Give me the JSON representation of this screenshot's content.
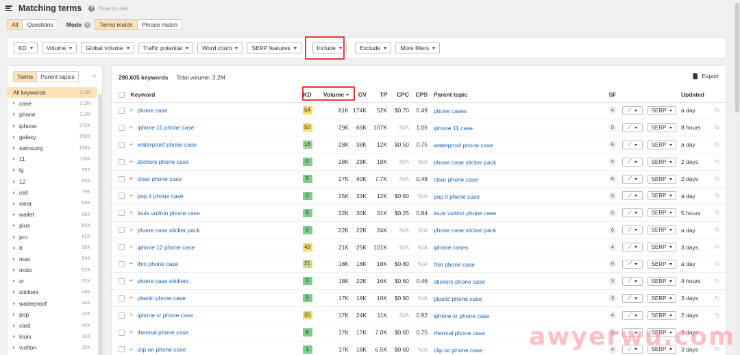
{
  "header": {
    "title": "Matching terms",
    "help_label": "How to use"
  },
  "mode_row": {
    "scope_options": [
      "All",
      "Questions"
    ],
    "mode_label": "Mode",
    "match_options": [
      "Terms match",
      "Phrase match"
    ]
  },
  "filters": [
    "KD",
    "Volume",
    "Global volume",
    "Traffic potential",
    "Word count",
    "SERP features",
    "Include",
    "Exclude",
    "More filters"
  ],
  "sidebar": {
    "tabs": [
      "Terms",
      "Parent topics"
    ],
    "collapse_glyph": "«",
    "all_label": "All keywords",
    "all_count": "3.2M",
    "items": [
      {
        "label": "case",
        "count": "3.2M"
      },
      {
        "label": "phone",
        "count": "3.2M"
      },
      {
        "label": "iphone",
        "count": "373K"
      },
      {
        "label": "galaxy",
        "count": "158K"
      },
      {
        "label": "samsung",
        "count": "158K"
      },
      {
        "label": "11",
        "count": "114K"
      },
      {
        "label": "lg",
        "count": "95K"
      },
      {
        "label": "12",
        "count": "80K"
      },
      {
        "label": "cell",
        "count": "79K"
      },
      {
        "label": "clear",
        "count": "69K"
      },
      {
        "label": "wallet",
        "count": "66K"
      },
      {
        "label": "plus",
        "count": "65K"
      },
      {
        "label": "pro",
        "count": "62K"
      },
      {
        "label": "6",
        "count": "55K"
      },
      {
        "label": "max",
        "count": "54K"
      },
      {
        "label": "moto",
        "count": "52K"
      },
      {
        "label": "xr",
        "count": "52K"
      },
      {
        "label": "stickers",
        "count": "48K"
      },
      {
        "label": "waterproof",
        "count": "44K"
      },
      {
        "label": "pop",
        "count": "42K"
      },
      {
        "label": "card",
        "count": "40K"
      },
      {
        "label": "louis",
        "count": "36K"
      },
      {
        "label": "vuitton",
        "count": "35K"
      }
    ]
  },
  "main": {
    "keyword_count": "280,605 keywords",
    "total_volume": "Total volume: 3.2M",
    "export_label": "Export",
    "columns": {
      "keyword": "Keyword",
      "kd": "KD",
      "volume": "Volume",
      "gv": "GV",
      "tp": "TP",
      "cpc": "CPC",
      "cps": "CPS",
      "parent": "Parent topic",
      "sf": "SF",
      "updated": "Updated"
    },
    "serp_label": "SERP",
    "trend_glyph": "⟋",
    "refresh_glyph": "↻",
    "rows": [
      {
        "keyword": "phone case",
        "kd": "54",
        "kd_color": "#fbd86a",
        "volume": "61K",
        "gv": "174K",
        "tp": "52K",
        "cpc": "$0.70",
        "cps": "0.49",
        "parent": "phone cases",
        "sf": "4",
        "updated": "a day"
      },
      {
        "keyword": "iphone 11 phone case",
        "kd": "50",
        "kd_color": "#fbd86a",
        "volume": "29K",
        "gv": "66K",
        "tp": "107K",
        "cpc": "N/A",
        "cps": "1.06",
        "parent": "iphone 11 case",
        "sf": "5",
        "updated": "8 hours"
      },
      {
        "keyword": "waterproof phone case",
        "kd": "18",
        "kd_color": "#9fd494",
        "volume": "28K",
        "gv": "38K",
        "tp": "12K",
        "cpc": "$0.50",
        "cps": "0.75",
        "parent": "waterproof phone case",
        "sf": "6",
        "updated": "a day"
      },
      {
        "keyword": "stickers phone case",
        "kd": "0",
        "kd_color": "#7ccf8a",
        "volume": "28K",
        "gv": "28K",
        "tp": "18K",
        "cpc": "N/A",
        "cps": "N/A",
        "parent": "phone case sticker pack",
        "sf": "5",
        "updated": "2 days"
      },
      {
        "keyword": "clear phone case",
        "kd": "5",
        "kd_color": "#7ccf8a",
        "volume": "27K",
        "gv": "40K",
        "tp": "7.7K",
        "cpc": "N/A",
        "cps": "0.48",
        "parent": "clear phone case",
        "sf": "6",
        "updated": "2 days"
      },
      {
        "keyword": "pop it phone case",
        "kd": "0",
        "kd_color": "#7ccf8a",
        "volume": "25K",
        "gv": "33K",
        "tp": "12K",
        "cpc": "$0.60",
        "cps": "N/A",
        "parent": "pop it phone case",
        "sf": "5",
        "updated": "a day"
      },
      {
        "keyword": "louis vuitton phone case",
        "kd": "8",
        "kd_color": "#7ccf8a",
        "volume": "22K",
        "gv": "30K",
        "tp": "31K",
        "cpc": "$0.25",
        "cps": "0.84",
        "parent": "louis vuitton phone case",
        "sf": "5",
        "updated": "5 hours"
      },
      {
        "keyword": "phone case sticker pack",
        "kd": "0",
        "kd_color": "#7ccf8a",
        "volume": "22K",
        "gv": "22K",
        "tp": "24K",
        "cpc": "N/A",
        "cps": "N/A",
        "parent": "phone case sticker pack",
        "sf": "6",
        "updated": "a day"
      },
      {
        "keyword": "iphone 12 phone case",
        "kd": "43",
        "kd_color": "#fbd86a",
        "volume": "21K",
        "gv": "25K",
        "tp": "101K",
        "cpc": "N/A",
        "cps": "N/A",
        "parent": "iphone cases",
        "sf": "4",
        "updated": "3 days"
      },
      {
        "keyword": "thin phone case",
        "kd": "21",
        "kd_color": "#c9e08a",
        "volume": "18K",
        "gv": "18K",
        "tp": "18K",
        "cpc": "$0.80",
        "cps": "N/A",
        "parent": "thin phone case",
        "sf": "6",
        "updated": "a day"
      },
      {
        "keyword": "phone case stickers",
        "kd": "0",
        "kd_color": "#7ccf8a",
        "volume": "18K",
        "gv": "22K",
        "tp": "16K",
        "cpc": "$0.60",
        "cps": "0.46",
        "parent": "stickers phone case",
        "sf": "3",
        "updated": "4 hours"
      },
      {
        "keyword": "plastic phone case",
        "kd": "9",
        "kd_color": "#7ccf8a",
        "volume": "17K",
        "gv": "18K",
        "tp": "16K",
        "cpc": "$0.90",
        "cps": "N/A",
        "parent": "plastic phone case",
        "sf": "3",
        "updated": "3 days"
      },
      {
        "keyword": "iphone xr phone case",
        "kd": "35",
        "kd_color": "#e8df6a",
        "volume": "17K",
        "gv": "24K",
        "tp": "11K",
        "cpc": "N/A",
        "cps": "0.92",
        "parent": "iphone xr phone case",
        "sf": "4",
        "updated": "2 days"
      },
      {
        "keyword": "thermal phone case",
        "kd": "6",
        "kd_color": "#7ccf8a",
        "volume": "17K",
        "gv": "17K",
        "tp": "7.0K",
        "cpc": "$0.60",
        "cps": "0.75",
        "parent": "thermal phone case",
        "sf": "6",
        "updated": "2 days"
      },
      {
        "keyword": "clip on phone case",
        "kd": "1",
        "kd_color": "#7ccf8a",
        "volume": "17K",
        "gv": "18K",
        "tp": "6.5K",
        "cpc": "$0.60",
        "cps": "N/A",
        "parent": "clip on phone case",
        "sf": "4",
        "updated": "3 days"
      }
    ]
  },
  "watermark": "awyerwu.com",
  "colors": {
    "accent": "#ffe2b8",
    "link": "#1a5fb4",
    "highlight_box": "#e53935"
  }
}
